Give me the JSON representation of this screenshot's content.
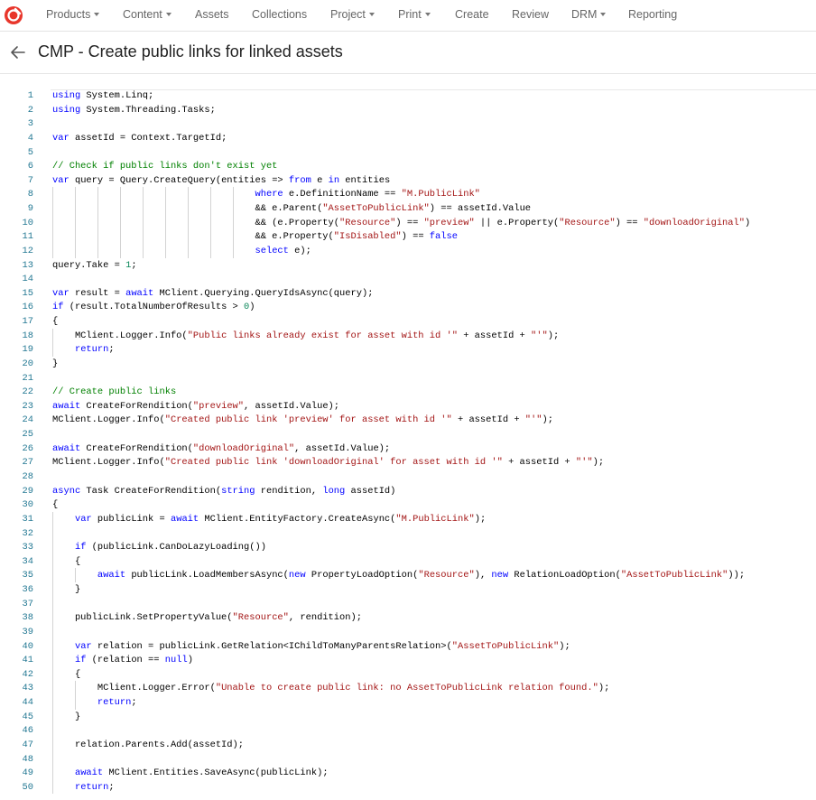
{
  "nav": {
    "items": [
      {
        "label": "Products",
        "dropdown": true
      },
      {
        "label": "Content",
        "dropdown": true
      },
      {
        "label": "Assets",
        "dropdown": false
      },
      {
        "label": "Collections",
        "dropdown": false
      },
      {
        "label": "Project",
        "dropdown": true
      },
      {
        "label": "Print",
        "dropdown": true
      },
      {
        "label": "Create",
        "dropdown": false
      },
      {
        "label": "Review",
        "dropdown": false
      },
      {
        "label": "DRM",
        "dropdown": true
      },
      {
        "label": "Reporting",
        "dropdown": false
      }
    ]
  },
  "header": {
    "title": "CMP - Create public links for linked assets"
  },
  "colors": {
    "brand": "#e8362b",
    "keyword": "#0000ff",
    "string": "#a31515",
    "comment": "#008000",
    "number": "#098658",
    "line_number": "#237893"
  },
  "code": {
    "lines": [
      [
        [
          "using ",
          "kw"
        ],
        [
          "System.Linq;",
          ""
        ]
      ],
      [
        [
          "using ",
          "kw"
        ],
        [
          "System.Threading.Tasks;",
          ""
        ]
      ],
      [],
      [
        [
          "var ",
          "kw"
        ],
        [
          "assetId = Context.TargetId;",
          ""
        ]
      ],
      [],
      [
        [
          "// Check if public links don't exist yet",
          "cm"
        ]
      ],
      [
        [
          "var ",
          "kw"
        ],
        [
          "query = Query.CreateQuery(entities => ",
          ""
        ],
        [
          "from ",
          "kw"
        ],
        [
          "e ",
          ""
        ],
        [
          "in ",
          "kw"
        ],
        [
          "entities",
          ""
        ]
      ],
      [
        [
          "                                    ",
          ""
        ],
        [
          "where ",
          "kw"
        ],
        [
          "e.DefinitionName == ",
          ""
        ],
        [
          "\"M.PublicLink\"",
          "str"
        ]
      ],
      [
        [
          "                                    && e.Parent(",
          ""
        ],
        [
          "\"AssetToPublicLink\"",
          "str"
        ],
        [
          ") == assetId.Value",
          ""
        ]
      ],
      [
        [
          "                                    && (e.Property(",
          ""
        ],
        [
          "\"Resource\"",
          "str"
        ],
        [
          ") == ",
          ""
        ],
        [
          "\"preview\"",
          "str"
        ],
        [
          " || e.Property(",
          ""
        ],
        [
          "\"Resource\"",
          "str"
        ],
        [
          ") == ",
          ""
        ],
        [
          "\"downloadOriginal\"",
          "str"
        ],
        [
          ")",
          ""
        ]
      ],
      [
        [
          "                                    && e.Property(",
          ""
        ],
        [
          "\"IsDisabled\"",
          "str"
        ],
        [
          ") == ",
          ""
        ],
        [
          "false",
          "kw"
        ]
      ],
      [
        [
          "                                    ",
          ""
        ],
        [
          "select ",
          "kw"
        ],
        [
          "e);",
          ""
        ]
      ],
      [
        [
          "query.Take = ",
          ""
        ],
        [
          "1",
          "num"
        ],
        [
          ";",
          ""
        ]
      ],
      [],
      [
        [
          "var ",
          "kw"
        ],
        [
          "result = ",
          ""
        ],
        [
          "await ",
          "kw"
        ],
        [
          "MClient.Querying.QueryIdsAsync(query);",
          ""
        ]
      ],
      [
        [
          "if ",
          "kw"
        ],
        [
          "(result.TotalNumberOfResults > ",
          ""
        ],
        [
          "0",
          "num"
        ],
        [
          ")",
          ""
        ]
      ],
      [
        [
          "{",
          ""
        ]
      ],
      [
        [
          "    MClient.Logger.Info(",
          ""
        ],
        [
          "\"Public links already exist for asset with id '\"",
          "str"
        ],
        [
          " + assetId + ",
          ""
        ],
        [
          "\"'\"",
          "str"
        ],
        [
          ");",
          ""
        ]
      ],
      [
        [
          "    ",
          ""
        ],
        [
          "return",
          "kw"
        ],
        [
          ";",
          ""
        ]
      ],
      [
        [
          "}",
          ""
        ]
      ],
      [],
      [
        [
          "// Create public links",
          "cm"
        ]
      ],
      [
        [
          "await ",
          "kw"
        ],
        [
          "CreateForRendition(",
          ""
        ],
        [
          "\"preview\"",
          "str"
        ],
        [
          ", assetId.Value);",
          ""
        ]
      ],
      [
        [
          "MClient.Logger.Info(",
          ""
        ],
        [
          "\"Created public link 'preview' for asset with id '\"",
          "str"
        ],
        [
          " + assetId + ",
          ""
        ],
        [
          "\"'\"",
          "str"
        ],
        [
          ");",
          ""
        ]
      ],
      [],
      [
        [
          "await ",
          "kw"
        ],
        [
          "CreateForRendition(",
          ""
        ],
        [
          "\"downloadOriginal\"",
          "str"
        ],
        [
          ", assetId.Value);",
          ""
        ]
      ],
      [
        [
          "MClient.Logger.Info(",
          ""
        ],
        [
          "\"Created public link 'downloadOriginal' for asset with id '\"",
          "str"
        ],
        [
          " + assetId + ",
          ""
        ],
        [
          "\"'\"",
          "str"
        ],
        [
          ");",
          ""
        ]
      ],
      [],
      [
        [
          "async ",
          "kw"
        ],
        [
          "Task CreateForRendition(",
          ""
        ],
        [
          "string ",
          "kw"
        ],
        [
          "rendition, ",
          ""
        ],
        [
          "long ",
          "kw"
        ],
        [
          "assetId)",
          ""
        ]
      ],
      [
        [
          "{",
          ""
        ]
      ],
      [
        [
          "    ",
          ""
        ],
        [
          "var ",
          "kw"
        ],
        [
          "publicLink = ",
          ""
        ],
        [
          "await ",
          "kw"
        ],
        [
          "MClient.EntityFactory.CreateAsync(",
          ""
        ],
        [
          "\"M.PublicLink\"",
          "str"
        ],
        [
          ");",
          ""
        ]
      ],
      [],
      [
        [
          "    ",
          ""
        ],
        [
          "if ",
          "kw"
        ],
        [
          "(publicLink.CanDoLazyLoading())",
          ""
        ]
      ],
      [
        [
          "    {",
          ""
        ]
      ],
      [
        [
          "        ",
          ""
        ],
        [
          "await ",
          "kw"
        ],
        [
          "publicLink.LoadMembersAsync(",
          ""
        ],
        [
          "new ",
          "kw"
        ],
        [
          "PropertyLoadOption(",
          ""
        ],
        [
          "\"Resource\"",
          "str"
        ],
        [
          "), ",
          ""
        ],
        [
          "new ",
          "kw"
        ],
        [
          "RelationLoadOption(",
          ""
        ],
        [
          "\"AssetToPublicLink\"",
          "str"
        ],
        [
          "));",
          ""
        ]
      ],
      [
        [
          "    }",
          ""
        ]
      ],
      [],
      [
        [
          "    publicLink.SetPropertyValue(",
          ""
        ],
        [
          "\"Resource\"",
          "str"
        ],
        [
          ", rendition);",
          ""
        ]
      ],
      [],
      [
        [
          "    ",
          ""
        ],
        [
          "var ",
          "kw"
        ],
        [
          "relation = publicLink.GetRelation<IChildToManyParentsRelation>(",
          ""
        ],
        [
          "\"AssetToPublicLink\"",
          "str"
        ],
        [
          ");",
          ""
        ]
      ],
      [
        [
          "    ",
          ""
        ],
        [
          "if ",
          "kw"
        ],
        [
          "(relation == ",
          ""
        ],
        [
          "null",
          "kw"
        ],
        [
          ")",
          ""
        ]
      ],
      [
        [
          "    {",
          ""
        ]
      ],
      [
        [
          "        MClient.Logger.Error(",
          ""
        ],
        [
          "\"Unable to create public link: no AssetToPublicLink relation found.\"",
          "str"
        ],
        [
          ");",
          ""
        ]
      ],
      [
        [
          "        ",
          ""
        ],
        [
          "return",
          "kw"
        ],
        [
          ";",
          ""
        ]
      ],
      [
        [
          "    }",
          ""
        ]
      ],
      [],
      [
        [
          "    relation.Parents.Add(assetId);",
          ""
        ]
      ],
      [],
      [
        [
          "    ",
          ""
        ],
        [
          "await ",
          "kw"
        ],
        [
          "MClient.Entities.SaveAsync(publicLink);",
          ""
        ]
      ],
      [
        [
          "    ",
          ""
        ],
        [
          "return",
          "kw"
        ],
        [
          ";",
          ""
        ]
      ]
    ]
  }
}
